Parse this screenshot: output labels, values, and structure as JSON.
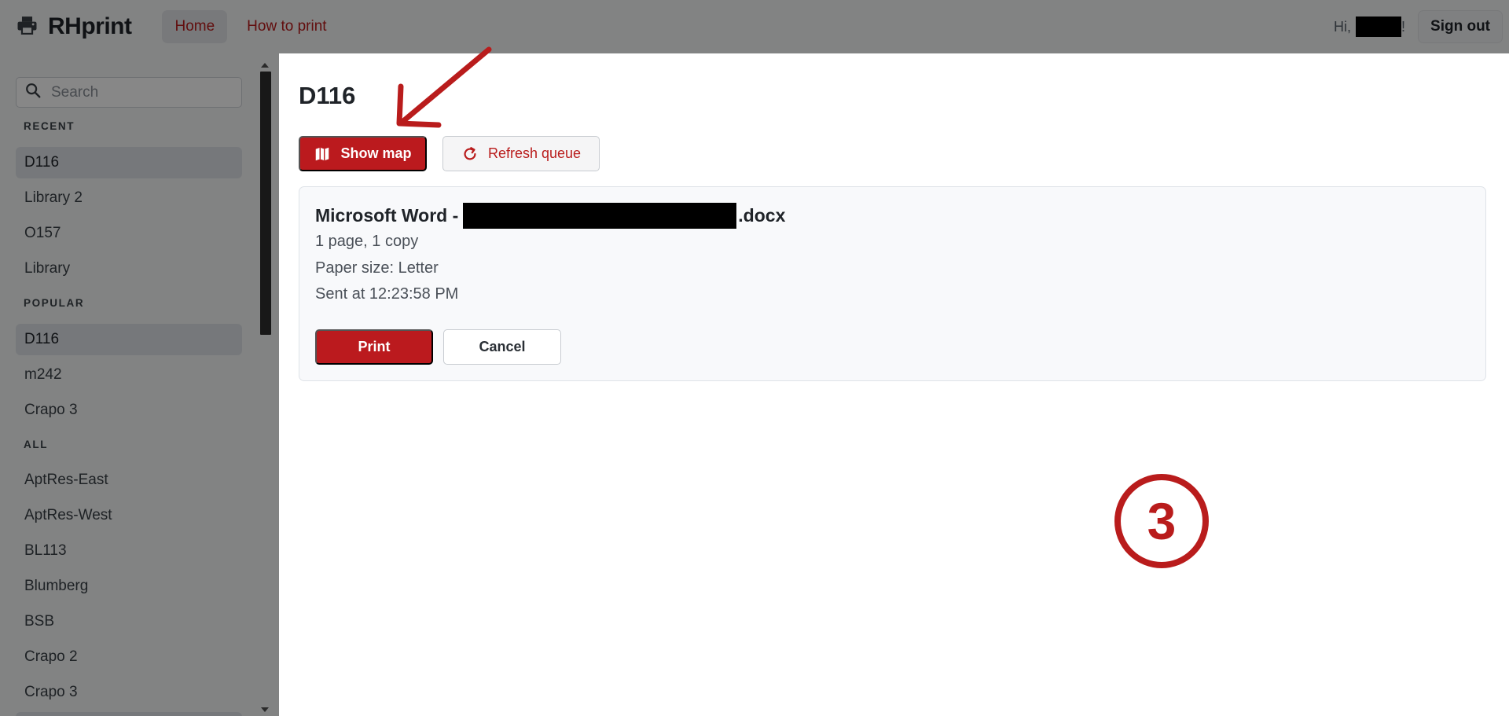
{
  "navbar": {
    "brand": "RHprint",
    "links": [
      {
        "label": "Home"
      },
      {
        "label": "How to print"
      }
    ],
    "greeting_prefix": "Hi,",
    "greeting_suffix": "!",
    "signout_label": "Sign out"
  },
  "sidebar": {
    "search_placeholder": "Search",
    "recent_heading": "RECENT",
    "recent": [
      "D116",
      "Library 2",
      "O157",
      "Library"
    ],
    "popular_heading": "POPULAR",
    "popular": [
      "D116",
      "m242",
      "Crapo 3"
    ],
    "all_heading": "ALL",
    "all": [
      "AptRes-East",
      "AptRes-West",
      "BL113",
      "Blumberg",
      "BSB",
      "Crapo 2",
      "Crapo 3"
    ]
  },
  "main": {
    "title": "D116",
    "show_map_label": "Show map",
    "refresh_label": "Refresh queue",
    "job": {
      "title_prefix": "Microsoft Word -",
      "title_suffix": ".docx",
      "pages": "1 page, 1 copy",
      "paper": "Paper size: Letter",
      "sent": "Sent at 12:23:58 PM",
      "print_label": "Print",
      "cancel_label": "Cancel"
    }
  },
  "annotation": {
    "step_number": "3",
    "accent_color": "#b91c1c"
  }
}
